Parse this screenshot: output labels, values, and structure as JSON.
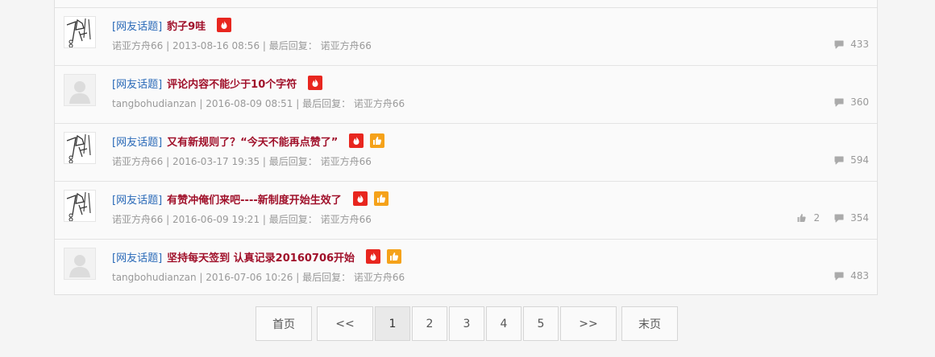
{
  "threads": [
    {
      "avatar_icon": "sketch-avatar-icon",
      "category": "[网友话题]",
      "title": "豹子9哇",
      "badges": [
        "hot"
      ],
      "meta": "诺亚方舟66 | 2013-08-16 08:56 | 最后回复： 诺亚方舟66",
      "likes": "",
      "comments": "433"
    },
    {
      "avatar_icon": "default-user-icon",
      "category": "[网友话题]",
      "title": "评论内容不能少于10个字符",
      "badges": [
        "hot"
      ],
      "meta": "tangbohudianzan | 2016-08-09 08:51 | 最后回复： 诺亚方舟66",
      "likes": "",
      "comments": "360"
    },
    {
      "avatar_icon": "sketch-avatar-icon",
      "category": "[网友话题]",
      "title": "又有新规则了？“今天不能再点赞了”",
      "badges": [
        "hot",
        "good"
      ],
      "meta": "诺亚方舟66 | 2016-03-17 19:35 | 最后回复： 诺亚方舟66",
      "likes": "",
      "comments": "594"
    },
    {
      "avatar_icon": "sketch-avatar-icon",
      "category": "[网友话题]",
      "title": "有赞冲俺们来吧----新制度开始生效了",
      "badges": [
        "hot",
        "good"
      ],
      "meta": "诺亚方舟66 | 2016-06-09 19:21 | 最后回复： 诺亚方舟66",
      "likes": "2",
      "comments": "354"
    },
    {
      "avatar_icon": "default-user-icon",
      "category": "[网友话题]",
      "title": "坚持每天签到 认真记录20160706开始",
      "badges": [
        "hot",
        "good"
      ],
      "meta": "tangbohudianzan | 2016-07-06 10:26 | 最后回复： 诺亚方舟66",
      "likes": "",
      "comments": "483"
    }
  ],
  "pagination": {
    "first": "首页",
    "prev": "<<",
    "pages": [
      "1",
      "2",
      "3",
      "4",
      "5"
    ],
    "current": "1",
    "next": ">>",
    "last": "末页"
  },
  "colors": {
    "category": "#2a6ab8",
    "title": "#a0102a",
    "hot_badge": "#e8261f",
    "good_badge": "#f5a21a",
    "meta": "#999999"
  }
}
